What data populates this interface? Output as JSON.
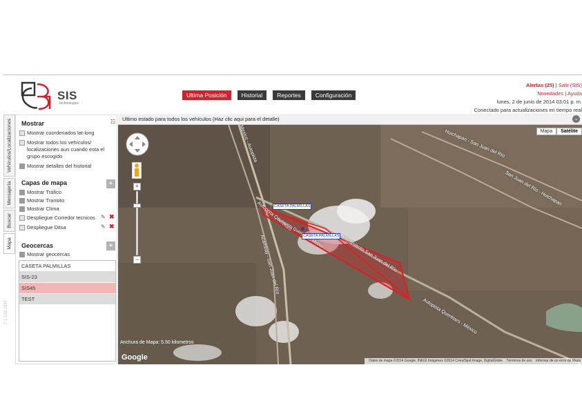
{
  "header": {
    "logo_text": "SIS",
    "logo_sub": "technologies",
    "nav": [
      {
        "label": "Ultima Posición",
        "active": true
      },
      {
        "label": "Historial",
        "active": false
      },
      {
        "label": "Reportes",
        "active": false
      },
      {
        "label": "Configuración",
        "active": false
      }
    ],
    "alerts_label": "Alertas (25)",
    "separator": "|",
    "exit_label": "Salir (SIS)",
    "news_label": "Novedades",
    "help_label": "Ayuda",
    "date": "lunes, 2 de junio de 2014 03:01 p. m.",
    "status": "Conectado para actualizaciones en tiempo real"
  },
  "side_tabs": [
    "Vehículos/Localizaciones",
    "Mensajería",
    "Buscar",
    "Mapa"
  ],
  "panel": {
    "mostrar": {
      "title": "Mostrar",
      "options": [
        {
          "label": "Mostrar coordenados lat-long",
          "checked": false
        },
        {
          "label": "Mostrar todos los vehículos/ localizaciones aun cuando esta el grupo escogido",
          "checked": false
        },
        {
          "label": "Mostrar detalles del historial",
          "checked": true
        }
      ]
    },
    "capas": {
      "title": "Capas de mapa",
      "options": [
        {
          "label": "Mostrar Tráfico",
          "checked": true
        },
        {
          "label": "Mostrar Transito",
          "checked": true
        },
        {
          "label": "Mostrar Clima",
          "checked": true
        },
        {
          "label": "Despliegue Corredor tecnicos",
          "checked": false
        },
        {
          "label": "Despliegue Ditsa",
          "checked": false
        }
      ]
    },
    "geocercas": {
      "title": "Geocercas",
      "show_label": "Mostrar geocercas",
      "show_checked": true,
      "items": [
        {
          "label": "CASETA PALMILLAS",
          "style": "plain"
        },
        {
          "label": "SIS-23",
          "style": "alt"
        },
        {
          "label": "SIS45",
          "style": "sel"
        },
        {
          "label": "TEST",
          "style": "alt"
        }
      ]
    },
    "version": "7.1.103.1937"
  },
  "map": {
    "header_text": "Ultimo estado para todos los vehículos (Haz clic aqui para el detalle)",
    "type_buttons": [
      "Mapa",
      "Satélite"
    ],
    "active_type": "Satélite",
    "scale_text": "Anchura de Mapa: 5.50 kilometros",
    "google_label": "Google",
    "attribution": "Datos de mapa ©2014 Google, INEGI Imágenes ©2014 Cnes/Spot Image, DigitalGlobe",
    "terms": "Términos de uso",
    "report": "Informar de un error de Maps",
    "markers": [
      "CASETA PALMILLAS",
      "CASETA PALMILLAS"
    ],
    "road_labels": [
      "Huichapan - San Juan del Río",
      "San Juan del Río - Huichapan",
      "Autopista Querétaro",
      "Mexico - Autopista",
      "Acambay - San Juan del Río",
      "Libramiento San Juan del Río",
      "Autopista Querétaro - México",
      "Autopista Querétaro - Mexico"
    ]
  },
  "colors": {
    "accent": "#c9252e",
    "nav_dark": "#3a3a3a",
    "geofence": "#e11c22"
  }
}
